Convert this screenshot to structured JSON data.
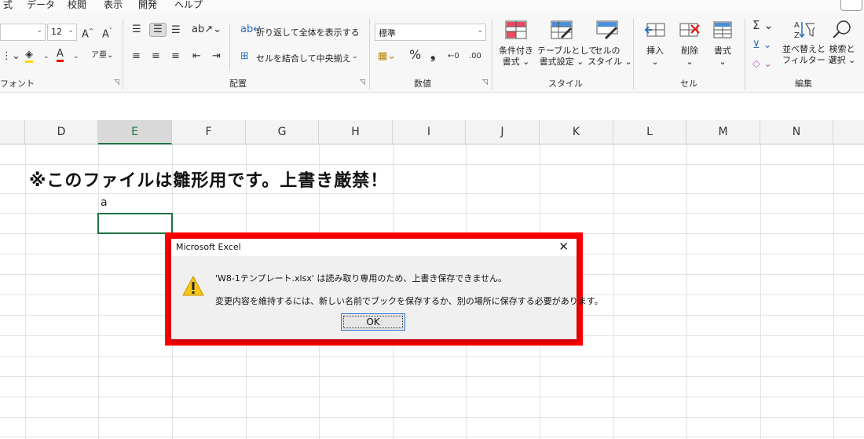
{
  "menu": {
    "items": [
      "式",
      "データ",
      "校閲",
      "表示",
      "開発",
      "ヘルプ"
    ]
  },
  "ribbon": {
    "font": {
      "size": "12",
      "group": "フォント"
    },
    "alignment": {
      "wrap_text": "折り返して全体を表示する",
      "merge_center": "セルを結合して中央揃え",
      "group": "配置"
    },
    "number": {
      "format": "標準",
      "group": "数値"
    },
    "styles": {
      "conditional_1": "条件付き",
      "conditional_2": "書式",
      "table_1": "テーブルとして",
      "table_2": "書式設定",
      "cell_1": "セルの",
      "cell_2": "スタイル",
      "group": "スタイル"
    },
    "cells": {
      "insert": "挿入",
      "delete": "削除",
      "format": "書式",
      "group": "セル"
    },
    "editing": {
      "sort_1": "並べ替えと",
      "sort_2": "フィルター",
      "find_1": "検索と",
      "find_2": "選択",
      "group": "編集"
    }
  },
  "sheet": {
    "columns": [
      "D",
      "E",
      "F",
      "G",
      "H",
      "I",
      "J",
      "K",
      "L",
      "M",
      "N"
    ],
    "active_column": "E",
    "title_text": "※このファイルは雛形用です。上書き厳禁！",
    "cell_e_text": "a"
  },
  "dialog": {
    "title": "Microsoft Excel",
    "close": "✕",
    "message1": "'W8-1テンプレート.xlsx' は読み取り専用のため、上書き保存できません。",
    "message2": "変更内容を維持するには、新しい名前でブックを保存するか、別の場所に保存する必要があります。",
    "ok": "OK"
  }
}
